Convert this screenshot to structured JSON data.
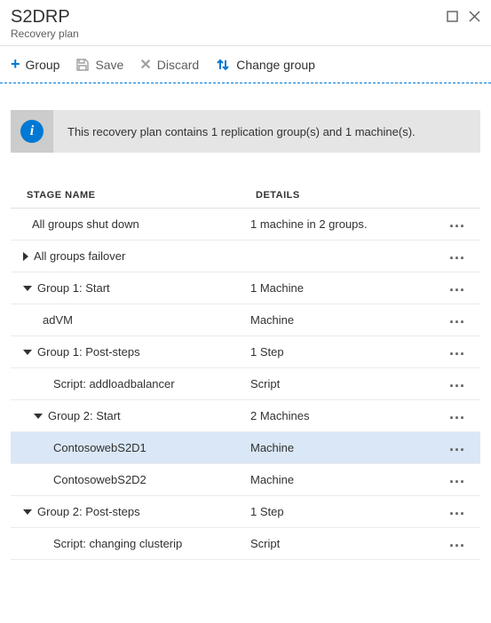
{
  "header": {
    "title": "S2DRP",
    "subtitle": "Recovery plan"
  },
  "toolbar": {
    "group_label": "Group",
    "save_label": "Save",
    "discard_label": "Discard",
    "change_group_label": "Change group"
  },
  "info_banner": {
    "text": "This recovery plan contains 1 replication group(s) and 1 machine(s)."
  },
  "table": {
    "headers": {
      "stage_name": "STAGE NAME",
      "details": "DETAILS"
    },
    "rows": [
      {
        "stage": "All groups shut down",
        "details": "1 machine in 2 groups.",
        "indent": "0",
        "caret": "none",
        "selected": false
      },
      {
        "stage": "All groups failover",
        "details": "",
        "indent": "1",
        "caret": "right",
        "selected": false
      },
      {
        "stage": "Group 1: Start",
        "details": "1 Machine",
        "indent": "1",
        "caret": "down",
        "selected": false
      },
      {
        "stage": "adVM",
        "details": "Machine",
        "indent": "3",
        "caret": "none",
        "selected": false
      },
      {
        "stage": "Group 1: Post-steps",
        "details": "1 Step",
        "indent": "1",
        "caret": "down",
        "selected": false
      },
      {
        "stage": "Script: addloadbalancer",
        "details": "Script",
        "indent": "4",
        "caret": "none",
        "selected": false
      },
      {
        "stage": "Group 2: Start",
        "details": "2 Machines",
        "indent": "2",
        "caret": "down",
        "selected": false
      },
      {
        "stage": "ContosowebS2D1",
        "details": "Machine",
        "indent": "4",
        "caret": "none",
        "selected": true
      },
      {
        "stage": "ContosowebS2D2",
        "details": "Machine",
        "indent": "4",
        "caret": "none",
        "selected": false
      },
      {
        "stage": "Group 2: Post-steps",
        "details": "1 Step",
        "indent": "1",
        "caret": "down",
        "selected": false
      },
      {
        "stage": "Script: changing clusterip",
        "details": "Script",
        "indent": "4",
        "caret": "none",
        "selected": false
      }
    ]
  }
}
